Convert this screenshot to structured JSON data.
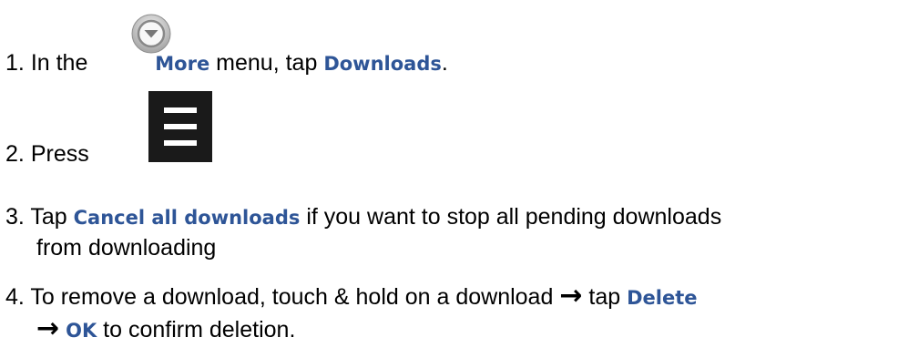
{
  "step1": {
    "number": "1.",
    "text_before": "In the",
    "more": "More",
    "text_mid": "menu, tap",
    "downloads": "Downloads",
    "end": "."
  },
  "step2": {
    "number": "2.",
    "text_before": "Press",
    "end": "."
  },
  "step3": {
    "number": "3.",
    "text_before": "Tap",
    "cancel": "Cancel all downloads",
    "text_after": "if you want to stop all pending downloads",
    "line2": "from downloading"
  },
  "step4": {
    "number": "4.",
    "text_before": "To remove a download, touch & hold on a download",
    "arrow": "→",
    "tap": "tap",
    "delete": "Delete",
    "ok": "OK",
    "line2_after": "to confirm deletion."
  },
  "icons": {
    "more_menu": "chevron-down-circle-icon",
    "hamburger": "hamburger-menu-icon",
    "accent_color": "#2E5597"
  }
}
